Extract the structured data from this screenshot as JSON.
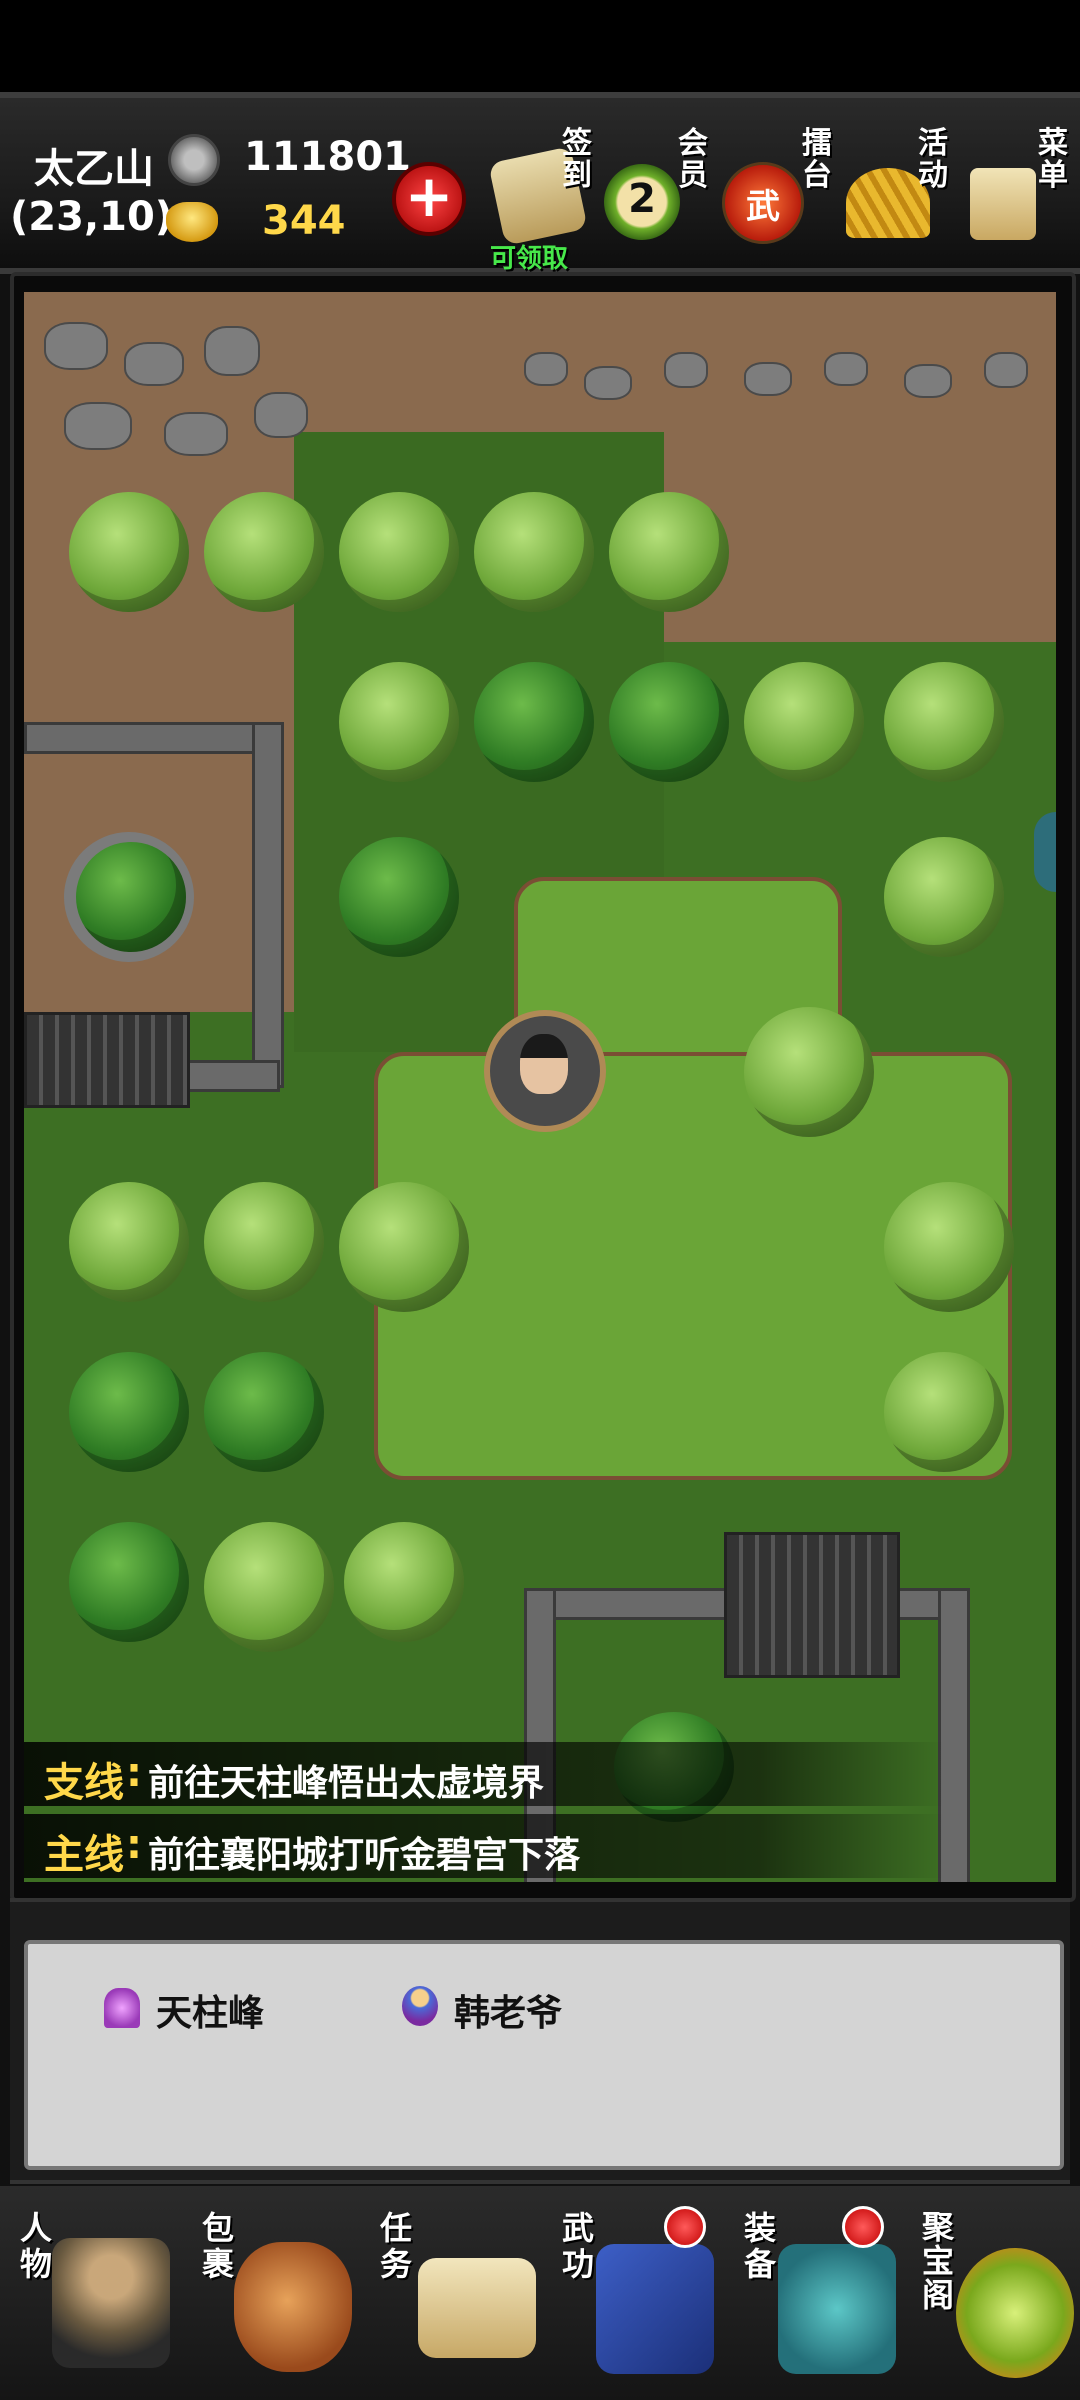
{
  "hud": {
    "location": "太乙山",
    "coords": "(23,10)",
    "silver": "111801",
    "gold": "344",
    "icons": [
      {
        "id": "signin",
        "label": "签到",
        "note": "可领取",
        "icon": "scroll-brush-icon"
      },
      {
        "id": "vip",
        "label": "会员",
        "level": "2",
        "icon": "vip-medal-icon"
      },
      {
        "id": "arena",
        "label": "擂台",
        "glyph": "武",
        "icon": "war-drum-icon"
      },
      {
        "id": "events",
        "label": "活动",
        "icon": "fan-icon"
      },
      {
        "id": "menu",
        "label": "菜单",
        "icon": "scroll-icon"
      }
    ]
  },
  "quests": [
    {
      "tag": "支线",
      "sep": ":",
      "text": "前往天柱峰悟出太虚境界"
    },
    {
      "tag": "主线",
      "sep": ":",
      "text": "前往襄阳城打听金碧宫下落"
    }
  ],
  "panel": {
    "entities": [
      {
        "name": "天柱峰",
        "icon": "portal-icon"
      },
      {
        "name": "韩老爷",
        "icon": "npc-icon"
      }
    ]
  },
  "nav": [
    {
      "label": "人物",
      "icon": "character-icon",
      "badge": false
    },
    {
      "label": "包裹",
      "icon": "bag-icon",
      "badge": false
    },
    {
      "label": "任务",
      "icon": "quest-scroll-icon",
      "badge": false
    },
    {
      "label": "武功",
      "icon": "martial-book-icon",
      "badge": true
    },
    {
      "label": "装备",
      "icon": "equipment-icon",
      "badge": true
    },
    {
      "label": "聚宝阁",
      "icon": "treasure-icon",
      "badge": false
    }
  ],
  "colors": {
    "gold": "#ffd84a",
    "green_note": "#47e84a",
    "badge_red": "#d40000"
  }
}
